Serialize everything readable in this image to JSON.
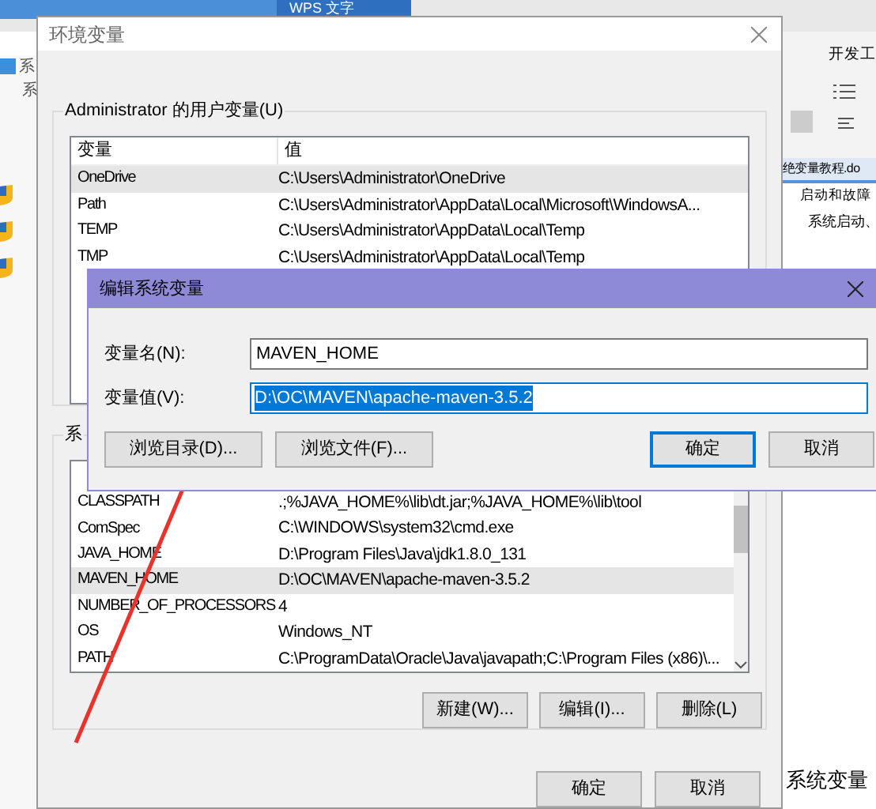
{
  "background": {
    "app_title": "WPS 文字",
    "left_texts": [
      "系",
      "系"
    ],
    "ribbon_tab": "开发工",
    "doc_tab": "绝变量教程.do",
    "panel_heading": "启动和故障",
    "panel_text": "系统启动、",
    "body_text": "系统变量"
  },
  "window": {
    "title": "环境变量"
  },
  "user_vars": {
    "label": "Administrator 的用户变量(U)",
    "columns": [
      "变量",
      "值"
    ],
    "rows": [
      {
        "name": "OneDrive",
        "value": "C:\\Users\\Administrator\\OneDrive",
        "selected": true
      },
      {
        "name": "Path",
        "value": "C:\\Users\\Administrator\\AppData\\Local\\Microsoft\\WindowsA...",
        "selected": false
      },
      {
        "name": "TEMP",
        "value": "C:\\Users\\Administrator\\AppData\\Local\\Temp",
        "selected": false
      },
      {
        "name": "TMP",
        "value": "C:\\Users\\Administrator\\AppData\\Local\\Temp",
        "selected": false
      }
    ]
  },
  "system_vars": {
    "label": "系",
    "rows": [
      {
        "name": "CLASSPATH",
        "value": ".;%JAVA_HOME%\\lib\\dt.jar;%JAVA_HOME%\\lib\\tool",
        "selected": false
      },
      {
        "name": "ComSpec",
        "value": "C:\\WINDOWS\\system32\\cmd.exe",
        "selected": false
      },
      {
        "name": "JAVA_HOME",
        "value": "D:\\Program Files\\Java\\jdk1.8.0_131",
        "selected": false
      },
      {
        "name": "MAVEN_HOME",
        "value": "D:\\OC\\MAVEN\\apache-maven-3.5.2",
        "selected": true
      },
      {
        "name": "NUMBER_OF_PROCESSORS",
        "value": "4",
        "selected": false
      },
      {
        "name": "OS",
        "value": "Windows_NT",
        "selected": false
      },
      {
        "name": "PATH",
        "value": "C:\\ProgramData\\Oracle\\Java\\javapath;C:\\Program Files (x86)\\...",
        "selected": false
      }
    ],
    "buttons": [
      "新建(W)...",
      "编辑(I)...",
      "删除(L)"
    ]
  },
  "buttons": [
    "确定",
    "取消"
  ],
  "edit_dialog": {
    "title": "编辑系统变量",
    "name_label": "变量名(N):",
    "name_value": "MAVEN_HOME",
    "value_label": "变量值(V):",
    "value_value": "D:\\OC\\MAVEN\\apache-maven-3.5.2",
    "value_selected": true,
    "buttons": [
      {
        "label": "浏览目录(D)...",
        "focused": false
      },
      {
        "label": "浏览文件(F)...",
        "focused": false
      },
      {
        "label": "确定",
        "focused": true
      },
      {
        "label": "取消",
        "focused": false
      }
    ]
  }
}
